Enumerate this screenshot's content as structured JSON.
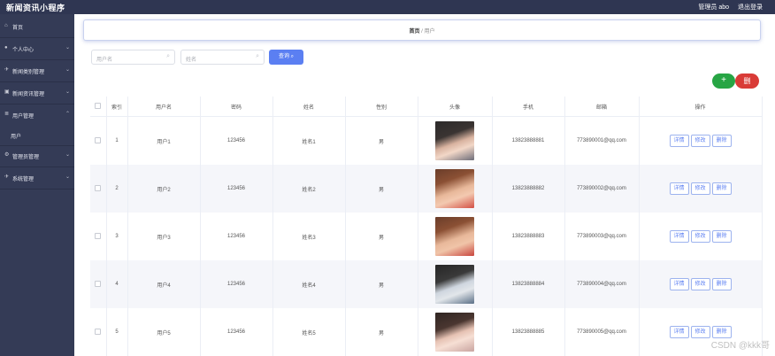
{
  "header": {
    "brand": "新闻资讯小程序",
    "admin": "管理员 abo",
    "logout": "退出登录"
  },
  "sidebar": {
    "items": [
      {
        "label": "首页",
        "icon": "home-icon",
        "glyph": "⌂",
        "chevron": ""
      },
      {
        "label": "个人中心",
        "icon": "user-icon",
        "glyph": "👤",
        "chevron": "⌄"
      },
      {
        "label": "新闻类别管理",
        "icon": "send-icon",
        "glyph": "✈",
        "chevron": "⌄"
      },
      {
        "label": "新闻资讯管理",
        "icon": "monitor-icon",
        "glyph": "▣",
        "chevron": "⌄"
      },
      {
        "label": "用户管理",
        "icon": "list-icon",
        "glyph": "≣",
        "chevron": "⌃"
      },
      {
        "label": "用户",
        "icon": "",
        "glyph": "",
        "chevron": ""
      },
      {
        "label": "管理员管理",
        "icon": "settings-icon",
        "glyph": "⚙",
        "chevron": "⌄"
      },
      {
        "label": "系统管理",
        "icon": "send-icon",
        "glyph": "✈",
        "chevron": "⌄"
      }
    ]
  },
  "breadcrumb": {
    "home": "首页",
    "sep": "/",
    "current": "用户"
  },
  "search": {
    "username_placeholder": "用户名",
    "name_placeholder": "姓名",
    "query_label": "查询",
    "search_glyph": "⌕"
  },
  "actions": {
    "add_label": "+",
    "delete_label": "删"
  },
  "table": {
    "headers": [
      "",
      "索引",
      "用户名",
      "密码",
      "姓名",
      "性别",
      "头像",
      "手机",
      "邮箱",
      "操作"
    ],
    "buttons": {
      "detail": "详情",
      "edit": "修改",
      "delete": "删除"
    },
    "rows": [
      {
        "index": "1",
        "username": "用户1",
        "password": "123456",
        "name": "姓名1",
        "gender": "男",
        "phone": "13823888881",
        "email": "773890001@qq.com"
      },
      {
        "index": "2",
        "username": "用户2",
        "password": "123456",
        "name": "姓名2",
        "gender": "男",
        "phone": "13823888882",
        "email": "773890002@qq.com"
      },
      {
        "index": "3",
        "username": "用户3",
        "password": "123456",
        "name": "姓名3",
        "gender": "男",
        "phone": "13823888883",
        "email": "773890003@qq.com"
      },
      {
        "index": "4",
        "username": "用户4",
        "password": "123456",
        "name": "姓名4",
        "gender": "男",
        "phone": "13823888884",
        "email": "773890004@qq.com"
      },
      {
        "index": "5",
        "username": "用户5",
        "password": "123456",
        "name": "姓名5",
        "gender": "男",
        "phone": "13823888885",
        "email": "773890005@qq.com"
      }
    ]
  },
  "watermark": "CSDN @kkk哥",
  "colors": {
    "sidebar": "#343b56",
    "topbar": "#2f3652",
    "primary": "#5b7ff2",
    "success": "#27a544",
    "danger": "#d93b37"
  }
}
